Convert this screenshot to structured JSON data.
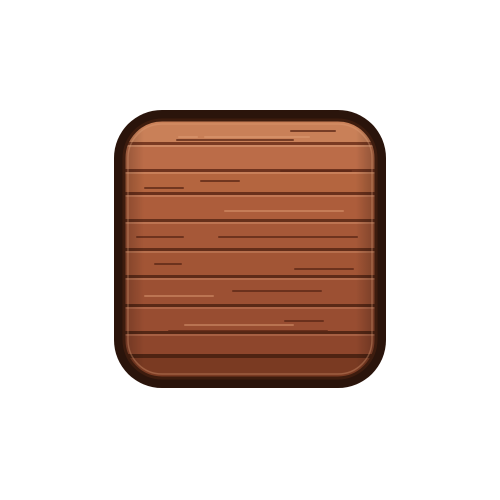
{
  "asset": {
    "kind": "wooden-plank-tile",
    "icon": "wood-tile-icon",
    "colors": {
      "background": "#ffffff",
      "outline": "#2a140b",
      "wood_light": "#c97f56",
      "wood_mid": "#a9593a",
      "wood_dark": "#74361f",
      "grain": "#5b2716",
      "highlight": "#e6a47c"
    }
  }
}
